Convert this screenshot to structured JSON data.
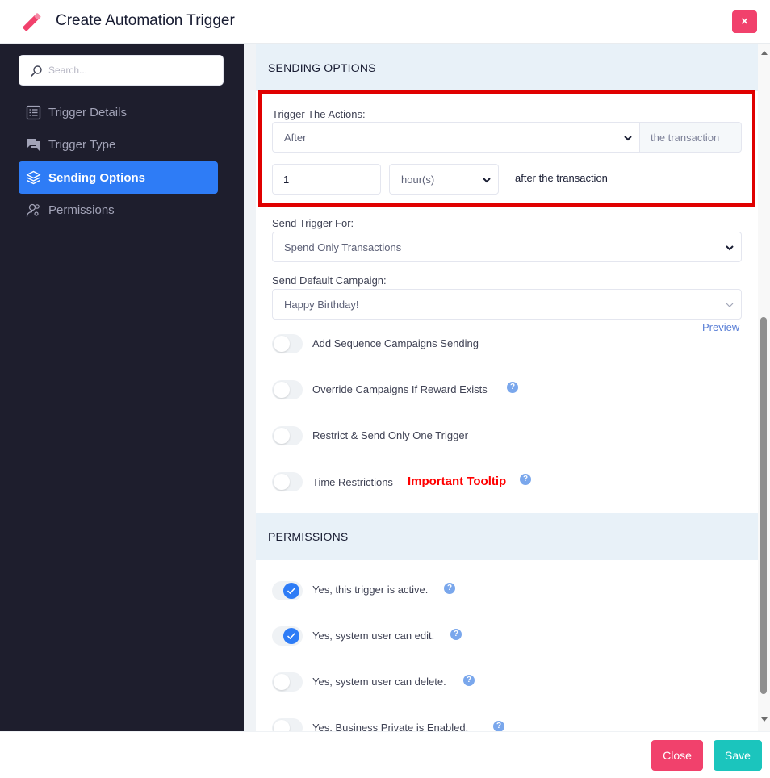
{
  "modal": {
    "title": "Create Automation Trigger",
    "close_symbol": "×",
    "pen_icon": "pencil-icon",
    "accent_color": "#f1416c"
  },
  "sidebar": {
    "search_placeholder": "Search...",
    "items": [
      {
        "label": "Trigger Details",
        "icon": "list-icon",
        "active": false
      },
      {
        "label": "Trigger Type",
        "icon": "chat-icon",
        "active": false
      },
      {
        "label": "Sending Options",
        "icon": "layers-icon",
        "active": true
      },
      {
        "label": "Permissions",
        "icon": "user-gear-icon",
        "active": false
      }
    ],
    "active_color": "#2e7cf6"
  },
  "sending_options": {
    "heading": "SENDING OPTIONS",
    "trigger_actions_label": "Trigger The Actions:",
    "trigger_actions_value": "After",
    "trigger_actions_addon": "the transaction",
    "amount_value": "1",
    "unit_value": "hour(s)",
    "after_text": "after the transaction",
    "send_trigger_for_label": "Send Trigger For:",
    "send_trigger_for_value": "Spend Only Transactions",
    "default_campaign_label": "Send Default Campaign:",
    "default_campaign_value": "Happy Birthday!",
    "preview_link": "Preview",
    "toggles": [
      {
        "label": "Add Sequence Campaigns Sending",
        "on": false,
        "help": false
      },
      {
        "label": "Override Campaigns If Reward Exists",
        "on": false,
        "help": true
      },
      {
        "label": "Restrict & Send Only One Trigger",
        "on": false,
        "help": false
      },
      {
        "label": "Time Restrictions",
        "on": false,
        "help": true
      }
    ],
    "important_tooltip": "Important Tooltip",
    "help_symbol": "?"
  },
  "permissions": {
    "heading": "PERMISSIONS",
    "toggles": [
      {
        "label": "Yes, this trigger is active.",
        "on": true
      },
      {
        "label": "Yes, system user can edit.",
        "on": true
      },
      {
        "label": "Yes, system user can delete.",
        "on": false
      },
      {
        "label": "Yes, Business Private is Enabled.",
        "on": false
      }
    ]
  },
  "footer": {
    "close_label": "Close",
    "save_label": "Save",
    "close_color": "#f1416c",
    "save_color": "#1bc5bd"
  }
}
